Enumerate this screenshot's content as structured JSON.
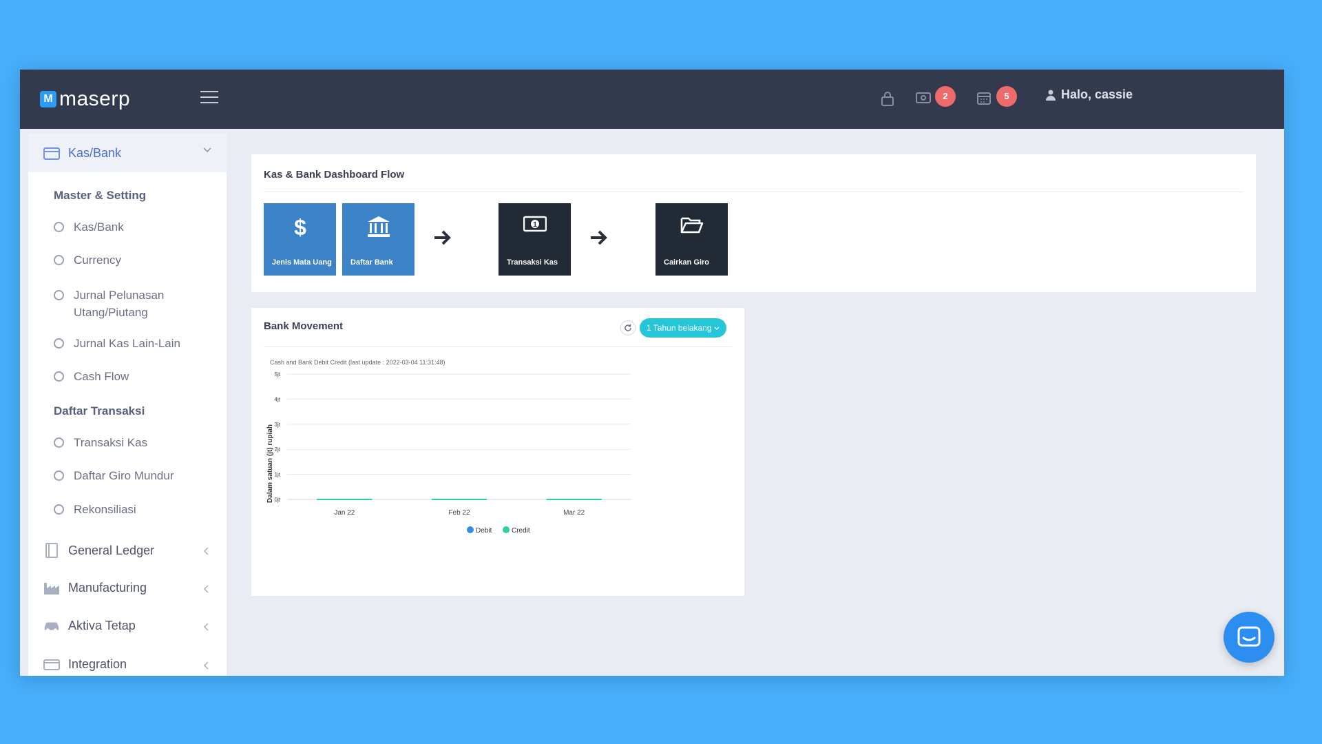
{
  "app": {
    "logo_mark": "M",
    "logo_text": "maserp",
    "notif_badge": "2",
    "calendar_badge": "5",
    "greeting": "Halo, cassie"
  },
  "sidebar": {
    "header": "Kas/Bank",
    "section_master": "Master & Setting",
    "master_items": [
      "Kas/Bank",
      "Currency",
      "Jurnal Pelunasan Utang/Piutang",
      "Jurnal Kas Lain-Lain",
      "Cash Flow"
    ],
    "section_transaksi": "Daftar Transaksi",
    "transaksi_items": [
      "Transaksi Kas",
      "Daftar Giro Mundur",
      "Rekonsiliasi"
    ],
    "groups": [
      "General Ledger",
      "Manufacturing",
      "Aktiva Tetap",
      "Integration"
    ]
  },
  "flow": {
    "title": "Kas & Bank Dashboard Flow",
    "tiles": [
      {
        "label": "Jenis Mata Uang",
        "icon": "dollar-icon"
      },
      {
        "label": "Daftar Bank",
        "icon": "bank-icon"
      },
      {
        "label": "Transaksi Kas",
        "icon": "money-icon"
      },
      {
        "label": "Cairkan Giro",
        "icon": "folder-open-icon"
      }
    ]
  },
  "bank_movement": {
    "title": "Bank Movement",
    "period": "1 Tahun belakang"
  },
  "chart_data": {
    "type": "line",
    "title": "Cash and Bank Debit Credit (last update : 2022-03-04 11:31:48)",
    "ylabel": "Dalam satuan (jt) rupiah",
    "xlabel": "",
    "categories": [
      "Jan 22",
      "Feb 22",
      "Mar 22"
    ],
    "y_ticks": [
      "0jt",
      "1jt",
      "2jt",
      "3jt",
      "4jt",
      "5jt"
    ],
    "ylim": [
      0,
      5
    ],
    "series": [
      {
        "name": "Debit",
        "values": [
          0,
          0,
          0
        ],
        "color": "#2f8fe0"
      },
      {
        "name": "Credit",
        "values": [
          0,
          0,
          0
        ],
        "color": "#2ed19a"
      }
    ],
    "grid": true,
    "legend": "bottom"
  }
}
